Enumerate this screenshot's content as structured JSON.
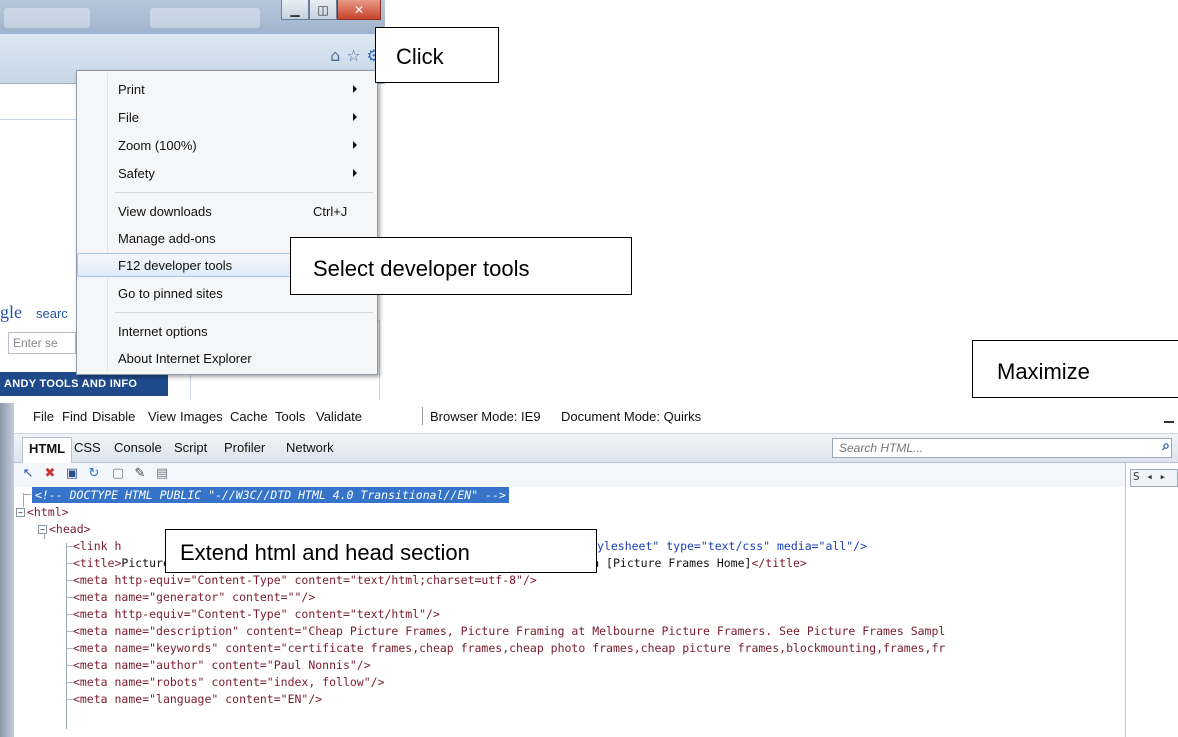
{
  "context_menu": {
    "items": [
      {
        "label": "Print",
        "has_submenu": true
      },
      {
        "label": "File",
        "has_submenu": true
      },
      {
        "label": "Zoom (100%)",
        "has_submenu": true
      },
      {
        "label": "Safety",
        "has_submenu": true
      },
      {
        "label": "View downloads",
        "shortcut": "Ctrl+J"
      },
      {
        "label": "Manage add-ons"
      },
      {
        "label": "F12 developer tools",
        "highlighted": true
      },
      {
        "label": "Go to pinned sites"
      },
      {
        "label": "Internet options"
      },
      {
        "label": "About Internet Explorer"
      }
    ]
  },
  "background_page": {
    "google_text": "gle",
    "search_link": "searc",
    "search_placeholder": "Enter se",
    "nav_bar": "ANDY TOOLS AND INFO"
  },
  "annotations": {
    "click": "Click",
    "select": "Select developer tools",
    "maximize": "Maximize",
    "extend": "Extend html and head section"
  },
  "devtools": {
    "menu": [
      "File",
      "Find",
      "Disable",
      "View",
      "Images",
      "Cache",
      "Tools",
      "Validate"
    ],
    "browser_mode": "Browser Mode: IE9",
    "document_mode": "Document Mode: Quirks",
    "tabs": [
      "HTML",
      "CSS",
      "Console",
      "Script",
      "Profiler",
      "Network"
    ],
    "search_placeholder": "Search HTML...",
    "style_panel_label": "S",
    "tree": {
      "doctype": "<!-- DOCTYPE HTML PUBLIC \"-//W3C//DTD HTML 4.0 Transitional//EN\" -->",
      "html_tag": "<html>",
      "head_tag": "<head>",
      "link_line_start": "<link h",
      "link_line_end": "ylesheet\" type=\"text/css\" media=\"all\"/>",
      "title_start": "<title>",
      "title_text": "Picture Framers, Picture Frames, Picture Framing, Melbourne Australia [Picture Frames Home]",
      "title_end": "</title>",
      "meta_lines": [
        "<meta http-equiv=\"Content-Type\" content=\"text/html;charset=utf-8\"/>",
        "<meta name=\"generator\" content=\"\"/>",
        "<meta http-equiv=\"Content-Type\" content=\"text/html\"/>",
        "<meta name=\"description\" content=\"Cheap Picture Frames, Picture Framing at Melbourne Picture Framers. See Picture Frames Sampl",
        "<meta name=\"keywords\" content=\"certificate frames,cheap frames,cheap photo frames,cheap picture frames,blockmounting,frames,fr",
        "<meta name=\"author\" content=\"Paul Nonnis\"/>",
        "<meta name=\"robots\" content=\"index, follow\"/>",
        "<meta name=\"language\" content=\"EN\"/>"
      ]
    }
  },
  "colors": {
    "menu_highlight": "#dfeaf8",
    "selection": "#3574c9",
    "tag": "#7a1b2f",
    "attr": "#b2261f",
    "value": "#1a3fb3"
  }
}
